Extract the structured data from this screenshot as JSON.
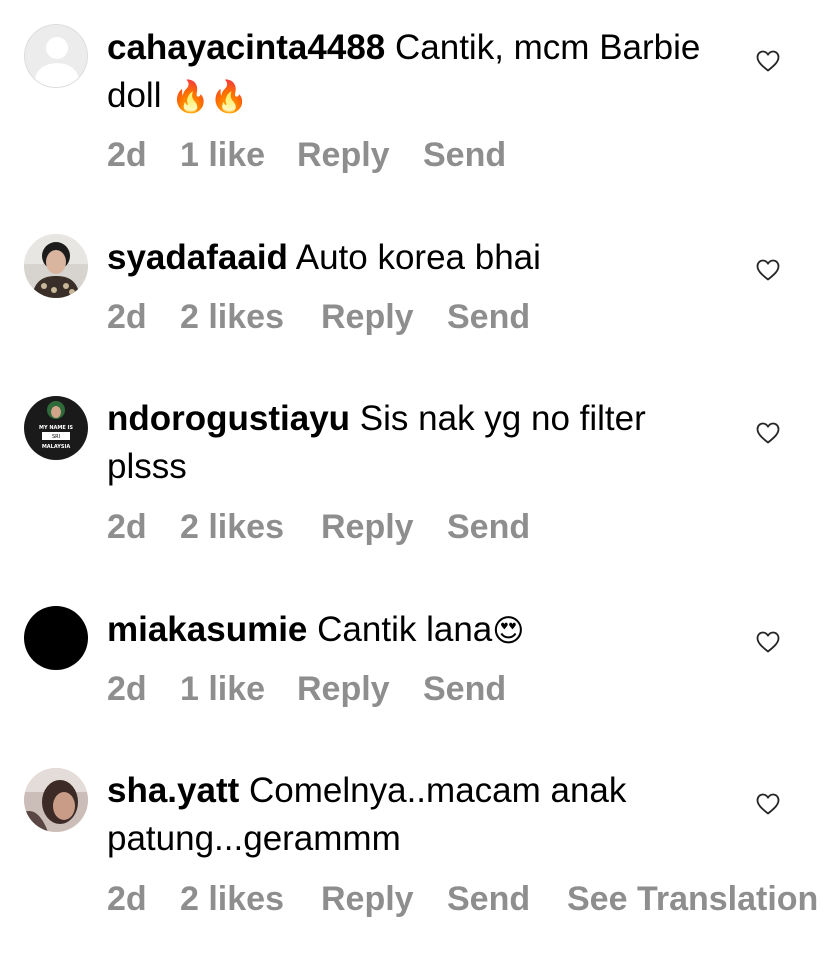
{
  "comments": [
    {
      "username": "cahayacinta4488",
      "text": "Cantik, mcm Barbie doll",
      "emoji": "🔥🔥",
      "time": "2d",
      "likes": "1 like",
      "reply": "Reply",
      "send": "Send"
    },
    {
      "username": "syadafaaid",
      "text": "Auto korea bhai",
      "emoji": "",
      "time": "2d",
      "likes": "2 likes",
      "reply": "Reply",
      "send": "Send"
    },
    {
      "username": "ndorogustiayu",
      "text": "Sis nak yg no filter plsss",
      "emoji": "",
      "time": "2d",
      "likes": "2 likes",
      "reply": "Reply",
      "send": "Send",
      "avatar_text": [
        "MY NAME IS",
        "SRI",
        "MALAYSIA"
      ]
    },
    {
      "username": "miakasumie",
      "text": "Cantik lana",
      "emoji": "😍",
      "time": "2d",
      "likes": "1 like",
      "reply": "Reply",
      "send": "Send"
    },
    {
      "username": "sha.yatt",
      "text": "Comelnya..macam anak patung...gerammm",
      "emoji": "",
      "time": "2d",
      "likes": "2 likes",
      "reply": "Reply",
      "send": "Send",
      "translation": "See Translation"
    }
  ],
  "colors": {
    "meta": "#8e8e8e",
    "text": "#000000",
    "heart_outline": "#262626"
  },
  "icons": {
    "like": "heart-outline-icon",
    "default_avatar": "default-user-icon"
  }
}
